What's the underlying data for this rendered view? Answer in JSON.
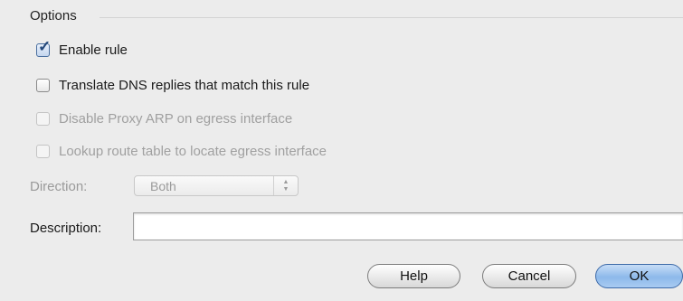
{
  "section": {
    "title": "Options"
  },
  "options": [
    {
      "label": "Enable rule",
      "checked": true,
      "enabled": true
    },
    {
      "label": "Translate DNS replies that match this rule",
      "checked": false,
      "enabled": true
    },
    {
      "label": "Disable Proxy ARP on egress interface",
      "checked": false,
      "enabled": false
    },
    {
      "label": "Lookup route table to locate egress interface",
      "checked": false,
      "enabled": false
    }
  ],
  "direction": {
    "label": "Direction:",
    "value": "Both",
    "enabled": false
  },
  "description": {
    "label": "Description:",
    "value": ""
  },
  "buttons": {
    "help": "Help",
    "cancel": "Cancel",
    "ok": "OK"
  },
  "colors": {
    "default_button": "#8db9ea",
    "disabled_text": "#a0a0a0"
  }
}
